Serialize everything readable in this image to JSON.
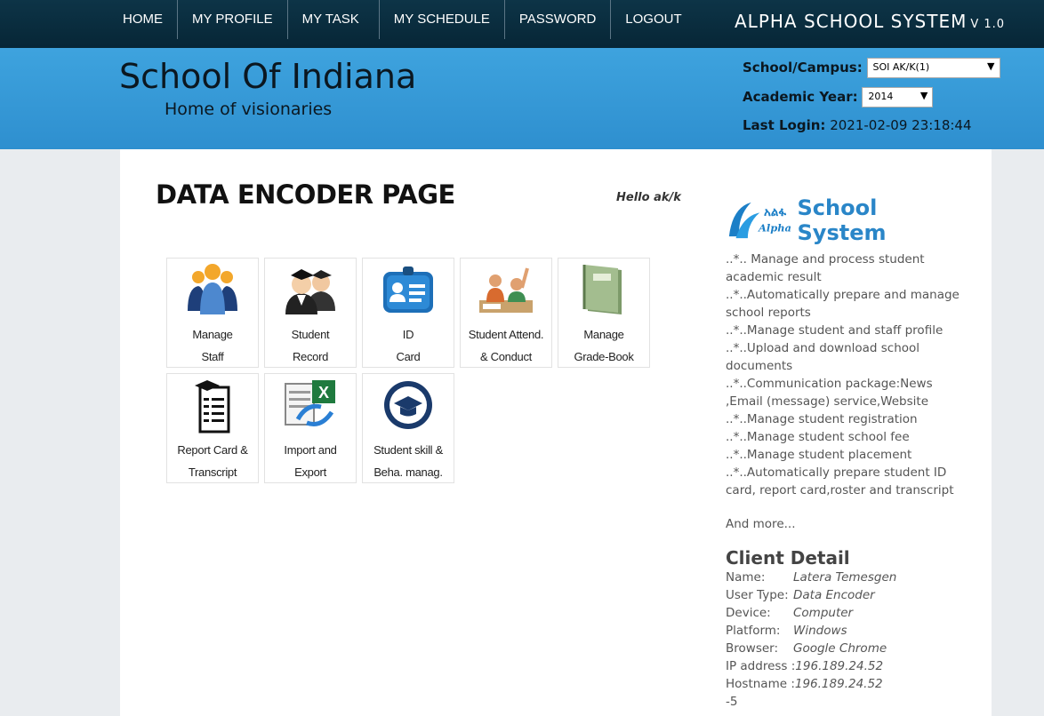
{
  "nav": {
    "items": [
      "HOME",
      "MY PROFILE",
      "MY TASK",
      "MY SCHEDULE",
      "PASSWORD",
      "LOGOUT"
    ],
    "brand": "ALPHA SCHOOL SYSTEM",
    "version": "V 1.0"
  },
  "header": {
    "school_name": "School Of Indiana",
    "slogan": "Home of visionaries",
    "campus_label": "School/Campus:",
    "campus_value": "SOI AK/K(1)",
    "year_label": "Academic Year:",
    "year_value": "2014",
    "last_login_label": "Last Login:",
    "last_login_value": "2021-02-09 23:18:44"
  },
  "main": {
    "title": "DATA ENCODER PAGE",
    "greeting": "Hello ak/k",
    "tiles": [
      {
        "line1": "Manage",
        "line2": "Staff",
        "icon": "staff-group-icon"
      },
      {
        "line1": "Student",
        "line2": "Record",
        "icon": "graduates-icon"
      },
      {
        "line1": "ID",
        "line2": "Card",
        "icon": "id-card-icon"
      },
      {
        "line1": "Student Attend.",
        "line2": "& Conduct",
        "icon": "classroom-icon"
      },
      {
        "line1": "Manage",
        "line2": "Grade-Book",
        "icon": "gradebook-icon"
      },
      {
        "line1": "Report Card &",
        "line2": "Transcript",
        "icon": "report-card-icon"
      },
      {
        "line1": "Import and",
        "line2": "Export",
        "icon": "import-export-icon"
      },
      {
        "line1": "Student skill &",
        "line2": "Beha. manag.",
        "icon": "graduation-cap-icon"
      }
    ]
  },
  "sidebar": {
    "logo_text_top": "አልፋ",
    "logo_text_bottom": "Alpha",
    "title": "School System",
    "features": [
      "..*.. Manage and process student academic result",
      "..*..Automatically prepare and manage school reports",
      "..*..Manage student and staff profile",
      "..*..Upload and download school documents",
      "..*..Communication package:News ,Email (message) service,Website",
      "..*..Manage student registration",
      "..*..Manage student school fee",
      "..*..Manage student placement",
      "..*..Automatically prepare student ID card, report card,roster and transcript"
    ],
    "and_more": "And more...",
    "client_detail_title": "Client Detail",
    "client": [
      {
        "k": "Name:",
        "v": "Latera Temesgen"
      },
      {
        "k": "User Type:",
        "v": "Data Encoder"
      },
      {
        "k": "Device:",
        "v": "Computer"
      },
      {
        "k": "Platform:",
        "v": "Windows"
      },
      {
        "k": "Browser:",
        "v": "Google Chrome"
      },
      {
        "k": "IP address :",
        "v": "196.189.24.52"
      },
      {
        "k": "Hostname :",
        "v": "196.189.24.52"
      }
    ],
    "trailing": "-5"
  },
  "colors": {
    "nav_bg": "#0d3447",
    "header_bg": "#3ea3de",
    "accent": "#2a86c8"
  }
}
